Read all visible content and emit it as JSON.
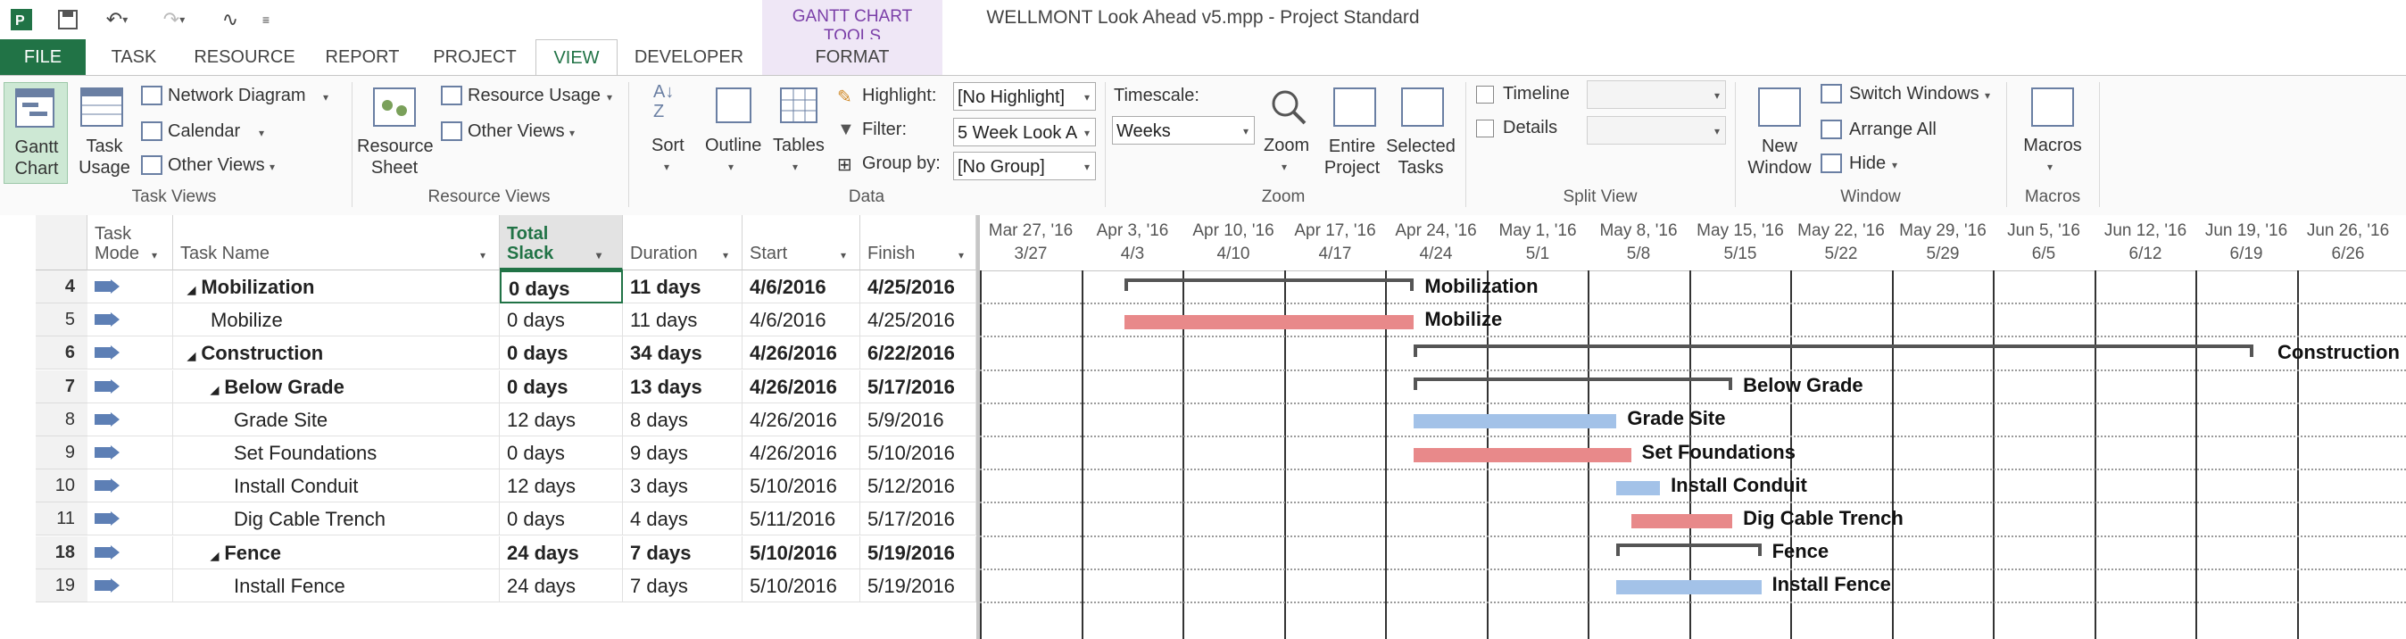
{
  "window": {
    "title": "WELLMONT Look Ahead v5.mpp - Project Standard",
    "context_group": "GANTT CHART TOOLS"
  },
  "tabs": [
    "FILE",
    "TASK",
    "RESOURCE",
    "REPORT",
    "PROJECT",
    "VIEW",
    "DEVELOPER",
    "FORMAT"
  ],
  "active_tab": "VIEW",
  "ribbon": {
    "task_views": {
      "label": "Task Views",
      "gantt_chart": "Gantt Chart",
      "task_usage": "Task Usage",
      "network_diagram": "Network Diagram",
      "calendar": "Calendar",
      "other_views": "Other Views"
    },
    "resource_views": {
      "label": "Resource Views",
      "resource_sheet": "Resource Sheet",
      "resource_usage": "Resource Usage",
      "other_views": "Other Views"
    },
    "data": {
      "label": "Data",
      "sort": "Sort",
      "outline": "Outline",
      "tables": "Tables",
      "highlight_label": "Highlight:",
      "highlight_value": "[No Highlight]",
      "filter_label": "Filter:",
      "filter_value": "5 Week Look A",
      "groupby_label": "Group by:",
      "groupby_value": "[No Group]"
    },
    "zoom": {
      "label": "Zoom",
      "timescale_label": "Timescale:",
      "timescale_value": "Weeks",
      "zoom": "Zoom",
      "entire_project": "Entire Project",
      "selected_tasks": "Selected Tasks"
    },
    "split_view": {
      "label": "Split View",
      "timeline": "Timeline",
      "details": "Details"
    },
    "window": {
      "label": "Window",
      "new_window": "New Window",
      "switch_windows": "Switch Windows",
      "arrange_all": "Arrange All",
      "hide": "Hide"
    },
    "macros": {
      "label": "Macros",
      "macros": "Macros"
    }
  },
  "columns": {
    "task_mode": "Task Mode",
    "task_name": "Task Name",
    "total_slack": "Total Slack",
    "duration": "Duration",
    "start": "Start",
    "finish": "Finish"
  },
  "rows": [
    {
      "id": "4",
      "name": "Mobilization",
      "slack": "0 days",
      "duration": "11 days",
      "start": "4/6/2016",
      "finish": "4/25/2016",
      "summary": true,
      "level": 0
    },
    {
      "id": "5",
      "name": "Mobilize",
      "slack": "0 days",
      "duration": "11 days",
      "start": "4/6/2016",
      "finish": "4/25/2016",
      "summary": false,
      "level": 1
    },
    {
      "id": "6",
      "name": "Construction",
      "slack": "0 days",
      "duration": "34 days",
      "start": "4/26/2016",
      "finish": "6/22/2016",
      "summary": true,
      "level": 0
    },
    {
      "id": "7",
      "name": "Below Grade",
      "slack": "0 days",
      "duration": "13 days",
      "start": "4/26/2016",
      "finish": "5/17/2016",
      "summary": true,
      "level": 1
    },
    {
      "id": "8",
      "name": "Grade Site",
      "slack": "12 days",
      "duration": "8 days",
      "start": "4/26/2016",
      "finish": "5/9/2016",
      "summary": false,
      "level": 2
    },
    {
      "id": "9",
      "name": "Set Foundations",
      "slack": "0 days",
      "duration": "9 days",
      "start": "4/26/2016",
      "finish": "5/10/2016",
      "summary": false,
      "level": 2
    },
    {
      "id": "10",
      "name": "Install Conduit",
      "slack": "12 days",
      "duration": "3 days",
      "start": "5/10/2016",
      "finish": "5/12/2016",
      "summary": false,
      "level": 2
    },
    {
      "id": "11",
      "name": "Dig Cable Trench",
      "slack": "0 days",
      "duration": "4 days",
      "start": "5/11/2016",
      "finish": "5/17/2016",
      "summary": false,
      "level": 2
    },
    {
      "id": "18",
      "name": "Fence",
      "slack": "24 days",
      "duration": "7 days",
      "start": "5/10/2016",
      "finish": "5/19/2016",
      "summary": true,
      "level": 1
    },
    {
      "id": "19",
      "name": "Install Fence",
      "slack": "24 days",
      "duration": "7 days",
      "start": "5/10/2016",
      "finish": "5/19/2016",
      "summary": false,
      "level": 2
    }
  ],
  "timescale": {
    "top": [
      "Mar 27, '16",
      "Apr 3, '16",
      "Apr 10, '16",
      "Apr 17, '16",
      "Apr 24, '16",
      "May 1, '16",
      "May 8, '16",
      "May 15, '16",
      "May 22, '16",
      "May 29, '16",
      "Jun 5, '16",
      "Jun 12, '16",
      "Jun 19, '16",
      "Jun 26, '16"
    ],
    "bottom": [
      "3/27",
      "4/3",
      "4/10",
      "4/17",
      "4/24",
      "5/1",
      "5/8",
      "5/15",
      "5/22",
      "5/29",
      "6/5",
      "6/12",
      "6/19",
      "6/26"
    ]
  },
  "gantt_labels": [
    "Mobilization",
    "Mobilize",
    "Construction",
    "Below Grade",
    "Grade Site",
    "Set Foundations",
    "Install Conduit",
    "Dig Cable Trench",
    "Fence",
    "Install Fence"
  ],
  "colors": {
    "file_tab": "#217346",
    "critical_bar": "#e8898a",
    "noncritical_bar": "#a3c2e8",
    "context_tab": "#7b3fa8"
  }
}
